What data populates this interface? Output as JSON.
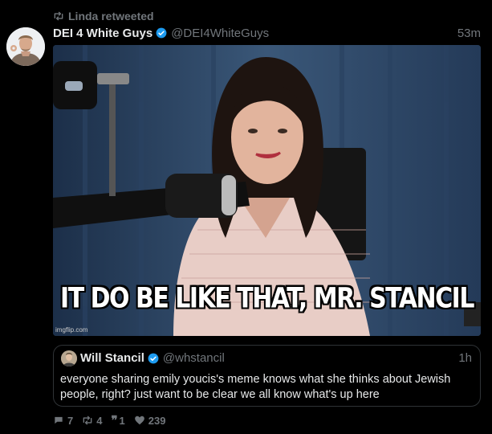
{
  "retweet": {
    "text": "Linda retweeted",
    "icon": "retweet-icon"
  },
  "tweet": {
    "display_name": "DEI 4 White Guys",
    "handle": "@DEI4WhiteGuys",
    "time": "53m",
    "verified_icon": "verified-badge-icon",
    "media": {
      "caption": "IT DO BE LIKE THAT, MR. STANCIL",
      "watermark": "imgflip.com"
    }
  },
  "quoted_tweet": {
    "display_name": "Will Stancil",
    "handle": "@whstancil",
    "time": "1h",
    "text": "everyone sharing emily youcis's meme knows what she thinks about Jewish people, right? just want to be clear we all know what's up here"
  },
  "actions": {
    "replies": "7",
    "retweets": "4",
    "quotes": "1",
    "likes": "239"
  },
  "colors": {
    "background": "#000000",
    "text": "#e7e9ea",
    "muted": "#71767b",
    "verified": "#1d9bf0"
  }
}
